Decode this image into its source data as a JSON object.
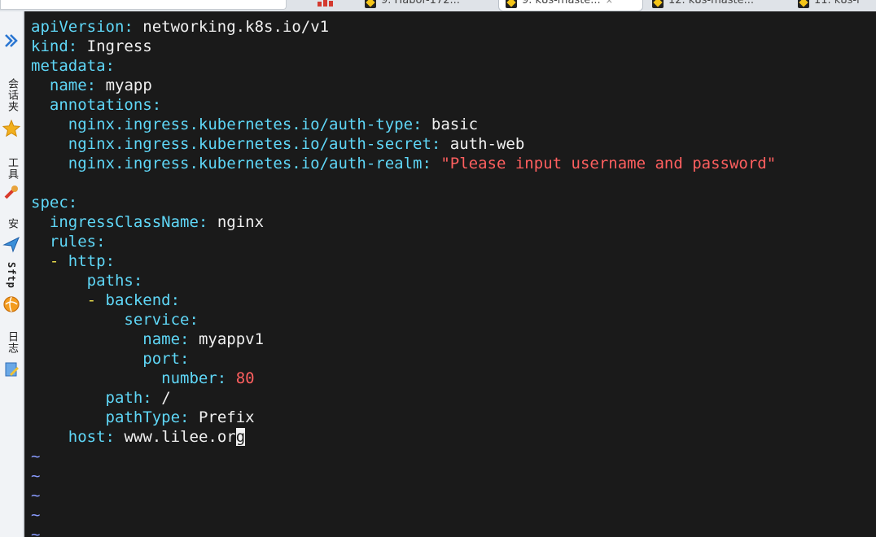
{
  "tabs": [
    {
      "label": "9. Habor-172..."
    },
    {
      "label": "9. k8s-maste...",
      "close": "×"
    },
    {
      "label": "12. k8s-maste..."
    },
    {
      "label": "11. k8s-r"
    }
  ],
  "sidebar": {
    "items": [
      {
        "label": "会话夹",
        "icon": "chevron-double-right-icon"
      },
      {
        "label": "工具",
        "icon": "star-icon"
      },
      {
        "label": "安",
        "icon": "send-icon"
      },
      {
        "label": "Sftp",
        "icon": "globe-icon"
      },
      {
        "label": "日志",
        "icon": "note-icon"
      }
    ]
  },
  "editor": {
    "lines": [
      {
        "indent": "",
        "key": "apiVersion",
        "sep": ":",
        "value": "networking.k8s.io/v1"
      },
      {
        "indent": "",
        "key": "kind",
        "sep": ":",
        "value": "Ingress"
      },
      {
        "indent": "",
        "key": "metadata",
        "sep": ":",
        "value": ""
      },
      {
        "indent": "  ",
        "key": "name",
        "sep": ":",
        "value": "myapp"
      },
      {
        "indent": "  ",
        "key": "annotations",
        "sep": ":",
        "value": ""
      },
      {
        "indent": "    ",
        "key": "nginx.ingress.kubernetes.io/auth-type",
        "sep": ":",
        "value": "basic"
      },
      {
        "indent": "    ",
        "key": "nginx.ingress.kubernetes.io/auth-secret",
        "sep": ":",
        "value": "auth-web"
      },
      {
        "indent": "    ",
        "key": "nginx.ingress.kubernetes.io/auth-realm",
        "sep": ":",
        "value": "\"Please input username and password\"",
        "vtype": "string"
      },
      {
        "indent": "",
        "key": "",
        "sep": "",
        "value": ""
      },
      {
        "indent": "",
        "key": "spec",
        "sep": ":",
        "value": ""
      },
      {
        "indent": "  ",
        "key": "ingressClassName",
        "sep": ":",
        "value": "nginx"
      },
      {
        "indent": "  ",
        "key": "rules",
        "sep": ":",
        "value": ""
      },
      {
        "indent": "  ",
        "dash": "-",
        "key": "http",
        "sep": ":",
        "value": ""
      },
      {
        "indent": "      ",
        "key": "paths",
        "sep": ":",
        "value": ""
      },
      {
        "indent": "      ",
        "dash": "-",
        "key": "backend",
        "sep": ":",
        "value": ""
      },
      {
        "indent": "          ",
        "key": "service",
        "sep": ":",
        "value": ""
      },
      {
        "indent": "            ",
        "key": "name",
        "sep": ":",
        "value": "myappv1"
      },
      {
        "indent": "            ",
        "key": "port",
        "sep": ":",
        "value": ""
      },
      {
        "indent": "              ",
        "key": "number",
        "sep": ":",
        "value": "80",
        "vtype": "number"
      },
      {
        "indent": "        ",
        "key": "path",
        "sep": ":",
        "value": "/"
      },
      {
        "indent": "        ",
        "key": "pathType",
        "sep": ":",
        "value": "Prefix"
      },
      {
        "indent": "    ",
        "key": "host",
        "sep": ":",
        "value": "www.lilee.or",
        "cursor": "g"
      }
    ],
    "tilde": "~",
    "tilde_count": 5
  }
}
